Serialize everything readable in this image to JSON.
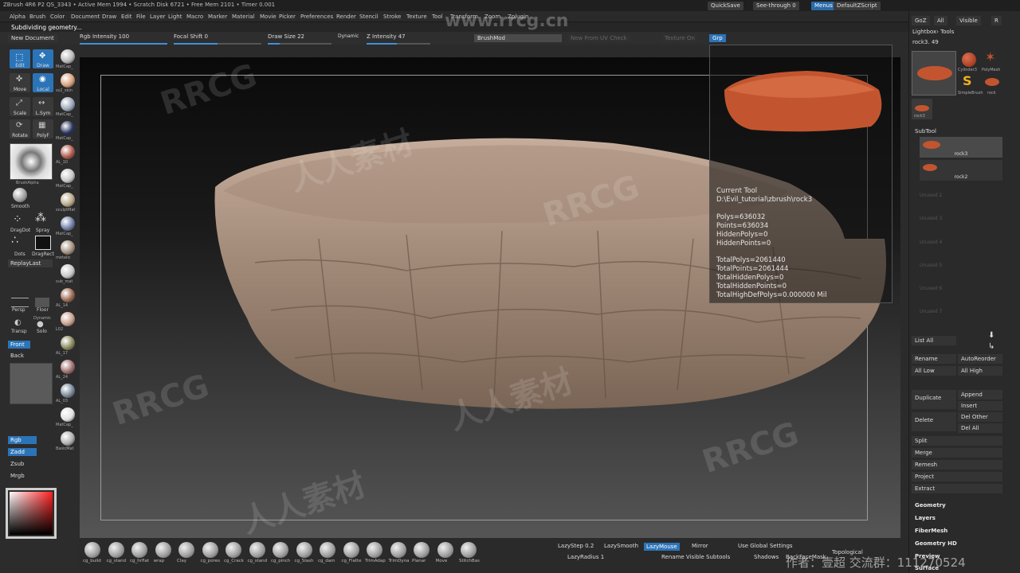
{
  "titlebar": {
    "text": "ZBrush 4R6 P2    QS_3343  •  Active Mem 1994  •  Scratch Disk 6721  •  Free Mem 2101  •  Timer 0.001",
    "quicksave": "QuickSave",
    "seethrough": "See-through  0",
    "menus": "Menus",
    "script": "DefaultZScript"
  },
  "menubar": [
    "Alpha",
    "Brush",
    "Color",
    "Document",
    "Draw",
    "Edit",
    "File",
    "Layer",
    "Light",
    "Macro",
    "Marker",
    "Material",
    "Movie",
    "Picker",
    "Preferences",
    "Render",
    "Stencil",
    "Stroke",
    "Texture",
    "Tool",
    "Transform",
    "Zoom",
    "Zplugin"
  ],
  "status": {
    "text": "Subdividing geometry..."
  },
  "sliders": {
    "new_document": "New Document",
    "rgb_intensity": "Rgb Intensity 100",
    "focal_shift": "Focal Shift 0",
    "draw_size": "Draw Size 22",
    "dynamic": "Dynamic",
    "z_intensity": "Z Intensity 47",
    "brushmod": "BrushMod",
    "new_from_uv": "New From UV Check",
    "texture_on": "Texture On",
    "grp": "Grp"
  },
  "left": {
    "tools": [
      {
        "name": "edit",
        "label": "Edit",
        "active": true
      },
      {
        "name": "draw",
        "label": "Draw",
        "active": true
      },
      {
        "name": "move",
        "label": "Move",
        "active": false
      },
      {
        "name": "local",
        "label": "Local",
        "active": true
      },
      {
        "name": "scale",
        "label": "Scale",
        "active": false
      },
      {
        "name": "lsym",
        "label": "L.Sym",
        "active": false
      },
      {
        "name": "rotate",
        "label": "Rotate",
        "active": false
      },
      {
        "name": "polyf",
        "label": "PolyF",
        "active": false
      }
    ],
    "materials": [
      {
        "label": "MatCap_",
        "color": "#b8b8b8"
      },
      {
        "label": "ss2_skin",
        "color": "#d9a07a"
      },
      {
        "label": "MatCap_",
        "color": "#9aa6b8"
      },
      {
        "label": "MatCap_",
        "color": "#28335c"
      },
      {
        "label": "AL_10",
        "color": "#b05a4a"
      },
      {
        "label": "MatCap_",
        "color": "#c6c6c6"
      },
      {
        "label": "sculptMat",
        "color": "#b8a88a"
      },
      {
        "label": "MatCap_",
        "color": "#6f7fa6"
      },
      {
        "label": "metalic",
        "color": "#a49280"
      },
      {
        "label": "sub_mat",
        "color": "#c8c8c8"
      },
      {
        "label": "AL_14",
        "color": "#9c6a52"
      },
      {
        "label": "L02",
        "color": "#c8a090"
      },
      {
        "label": "AL_17",
        "color": "#8a8a60"
      },
      {
        "label": "AL_24",
        "color": "#a07070"
      },
      {
        "label": "AL_03",
        "color": "#7a8a9a"
      },
      {
        "label": "MatCap_",
        "color": "#e0e0e0"
      },
      {
        "label": "BasicMat",
        "color": "#b0b0b0"
      }
    ],
    "brushalpha": "BrushAlpha",
    "smooth": "Smooth",
    "dragdot": "DragDot",
    "spray": "Spray",
    "dots": "Dots",
    "dragrect": "DragRect",
    "replaylast": "ReplayLast",
    "persp": "Persp",
    "floor": "Floor",
    "dynamic": "Dynamic",
    "lsym2": "Solo",
    "transp": "Transp",
    "front": "Front",
    "back": "Back",
    "rgb": "Rgb",
    "zadd": "Zadd",
    "zsub": "Zsub",
    "mrgb": "Mrgb"
  },
  "toolinfo": {
    "title": "Current Tool",
    "path": "D:\\Evil_tutorial\\zbrush\\rock3",
    "polys": "Polys=636032",
    "points": "Points=636034",
    "hiddenpolys": "HiddenPolys=0",
    "hiddenpoints": "HiddenPoints=0",
    "totalpolys": "TotalPolys=2061440",
    "totalpoints": "TotalPoints=2061444",
    "totalhiddenpolys": "TotalHiddenPolys=0",
    "totalhiddenpoints": "TotalHiddenPoints=0",
    "highdef": "TotalHighDefPolys=0.000000 Mil"
  },
  "right": {
    "goz": "GoZ",
    "all": "All",
    "visible": "Visible",
    "r": "R",
    "lightbox": "Lightbox› Tools",
    "rockname": "rock3. 49",
    "thumbs": [
      "Cylinder3",
      "PolyMesh",
      "SimpleBrush",
      "rock",
      "rock3"
    ],
    "subtool_title": "SubTool",
    "subtools": [
      "rock3",
      "rock2"
    ],
    "empty": [
      "Unused 2",
      "Unused 3",
      "Unused 4",
      "Unused 5",
      "Unused 6",
      "Unused 7"
    ],
    "listall": "List All",
    "rename": "Rename",
    "autoreorder": "AutoReorder",
    "alllow": "All Low",
    "allhigh": "All High",
    "duplicate": "Duplicate",
    "append": "Append",
    "insert": "Insert",
    "delete": "Delete",
    "delother": "Del Other",
    "delall": "Del All",
    "split": "Split",
    "merge": "Merge",
    "remesh": "Remesh",
    "project": "Project",
    "extract": "Extract",
    "sections": [
      "Geometry",
      "Layers",
      "FiberMesh",
      "Geometry HD",
      "Preview",
      "Surface"
    ]
  },
  "bottom": {
    "brushes": [
      "cg_build",
      "cg_stand",
      "cg_hrflat",
      "wrap",
      "Clay",
      "cg_pores",
      "cg_Crack",
      "cg_stand",
      "cg_pinch",
      "cg_Slash",
      "cg_dam",
      "cg_Flatte",
      "TrimAdap",
      "TrimDyna",
      "Planar",
      "Move",
      "StitchBas"
    ],
    "lazystep": "LazyStep 0.2",
    "lazysmooth": "LazySmooth",
    "lazymouse": "LazyMouse",
    "mirror": "Mirror",
    "useglobal": "Use Global Settings",
    "lazyradius": "LazyRadius 1",
    "rename_visible": "Rename Visible Subtools",
    "shadows": "Shadows",
    "backface": "BackFaceMask",
    "topological": "Topological"
  },
  "watermark": {
    "url": "www.rrcg.cn",
    "brand": "RRCG",
    "cn": "人人素材",
    "footer": "作者：壹超    交流群：111270524"
  }
}
